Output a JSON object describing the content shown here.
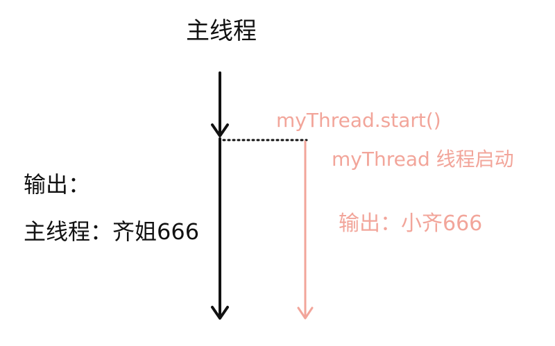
{
  "main_thread": {
    "title": "主线程",
    "output_heading": "输出：",
    "output_value": "主线程：齐姐666"
  },
  "my_thread": {
    "start_call": "myThread.start()",
    "started": "myThread 线程启动",
    "output": "输出：小齐666"
  },
  "colors": {
    "main_line": "#111111",
    "thread_accent": "#f2a59a"
  }
}
